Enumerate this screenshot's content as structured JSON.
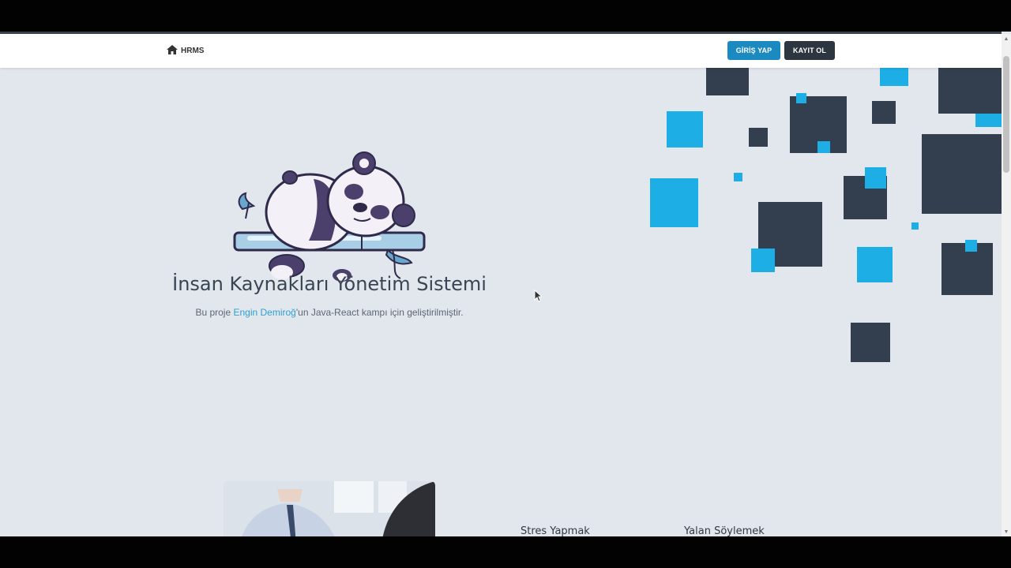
{
  "navbar": {
    "brand_label": "HRMS",
    "brand_icon": "home-icon",
    "login_button": "GİRİŞ YAP",
    "register_button": "KAYIT OL"
  },
  "hero": {
    "title": "İnsan Kaynakları Yönetim Sistemi",
    "subtitle_prefix": "Bu proje ",
    "subtitle_link": "Engin Demiroğ",
    "subtitle_suffix": "'un Java-React kampı için geliştirilmiştir."
  },
  "features": {
    "items": [
      {
        "label": "Stres Yapmak"
      },
      {
        "label": "Yalan Söylemek"
      }
    ]
  },
  "colors": {
    "primary_blue": "#1a8ac1",
    "dark_navy": "#2c3540",
    "background": "#e2e7ee",
    "square_dark": "#333f4e",
    "square_blue": "#1eaee6",
    "link": "#2f9fd0"
  }
}
